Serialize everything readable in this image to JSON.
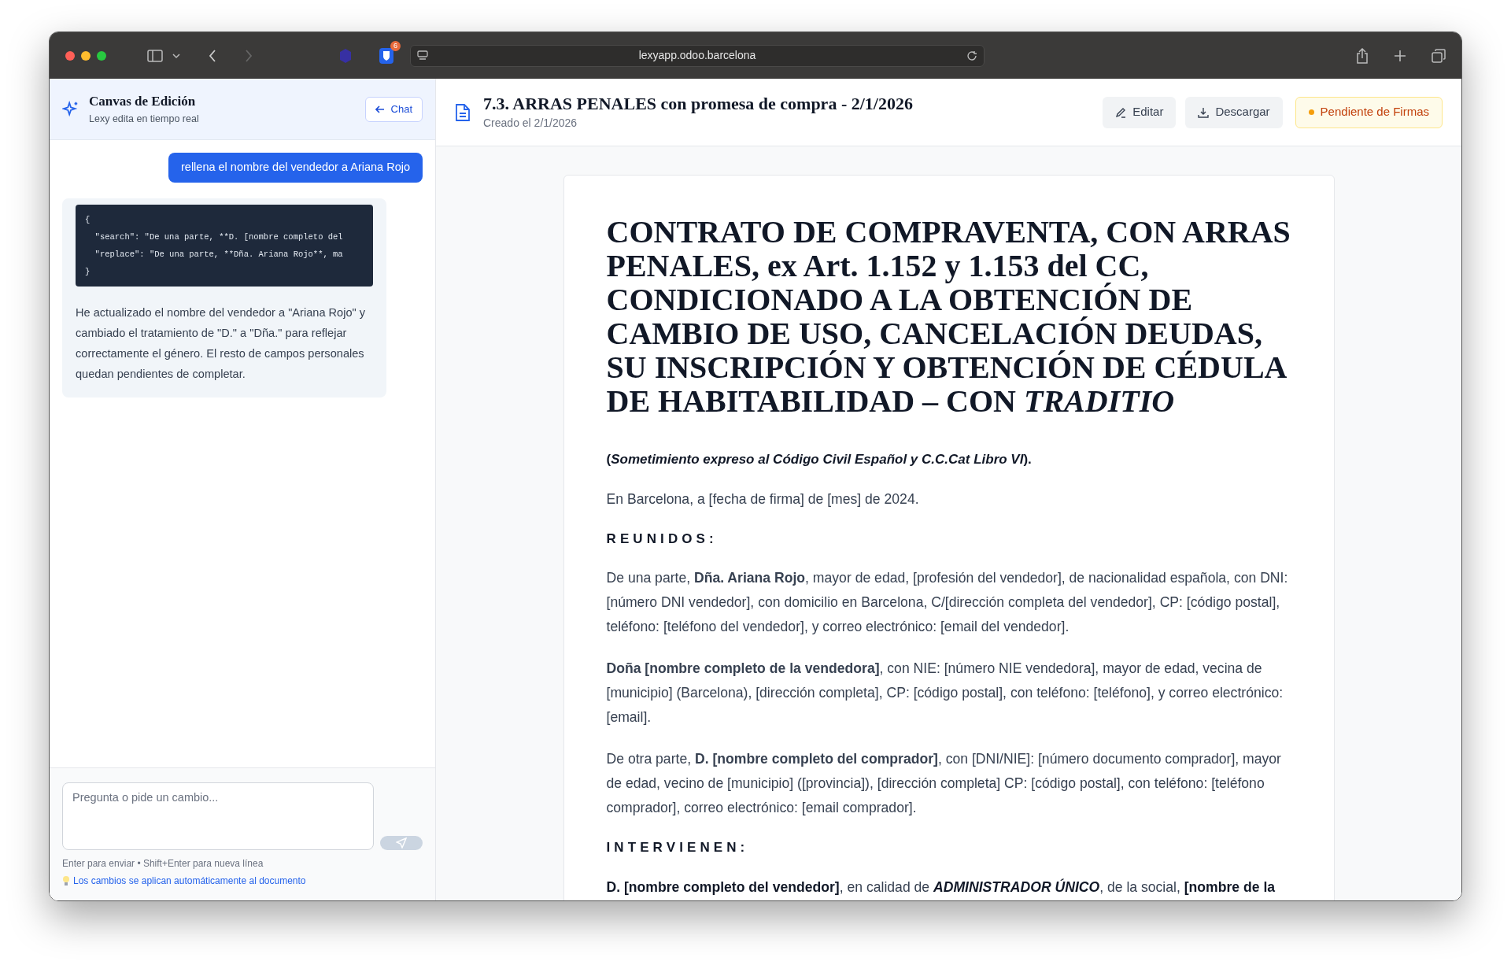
{
  "browser": {
    "url": "lexyapp.odoo.barcelona",
    "extension_badge": "6",
    "back_disabled": false,
    "forward_disabled": true
  },
  "chat_panel": {
    "title": "Canvas de Edición",
    "subtitle": "Lexy edita en tiempo real",
    "chat_button": "Chat",
    "messages": [
      {
        "kind": "user",
        "text": "rellena el nombre del vendedor a Ariana Rojo"
      },
      {
        "kind": "assistant",
        "code": [
          "{",
          "  \"search\": \"De una parte, **D. [nombre completo del",
          "  \"replace\": \"De una parte, **Dña. Ariana Rojo**, ma",
          "}"
        ],
        "text": "He actualizado el nombre del vendedor a \"Ariana Rojo\" y cambiado el tratamiento de \"D.\" a \"Dña.\" para reflejar correctamente el género. El resto de campos personales quedan pendientes de completar."
      }
    ],
    "input": {
      "placeholder": "Pregunta o pide un cambio..."
    },
    "send_disabled": true,
    "hint": "Enter para enviar • Shift+Enter para nueva línea",
    "tip": "Los cambios se aplican automáticamente al documento"
  },
  "document_header": {
    "title": "7.3. ARRAS PENALES con promesa de compra - 2/1/2026",
    "created": "Creado el 2/1/2026",
    "buttons": [
      {
        "kind": "edit",
        "label": "Editar"
      },
      {
        "kind": "download",
        "label": "Descargar"
      }
    ],
    "status": {
      "label": "Pendiente de Firmas",
      "color": "#f59e0b"
    }
  },
  "document": {
    "title": "CONTRATO DE COMPRAVENTA, CON ARRAS PENALES, ex Art. 1.152 y 1.153 del CC, CONDICIONADO A LA OBTENCIÓN DE CAMBIO DE USO, CANCELACIÓN DEUDAS, SU INSCRIPCIÓN Y OBTENCIÓN DE CÉDULA DE HABITABILIDAD – CON *TRADITIO*",
    "blocks": [
      {
        "kind": "bold",
        "text": "(*Sometimiento expreso al Código Civil Español y C.C.Cat Libro VI*)."
      },
      {
        "kind": "paragraph",
        "text": "En Barcelona, a [fecha de firma] de [mes] de 2024."
      },
      {
        "kind": "heading",
        "text": "REUNIDOS:"
      },
      {
        "kind": "paragraph",
        "text": "De una parte, **Dña. Ariana Rojo**, mayor de edad, [profesión del vendedor], de nacionalidad española, con DNI: [número DNI vendedor], con domicilio en Barcelona, C/[dirección completa del vendedor], CP: [código postal], teléfono: [teléfono del vendedor], y correo electrónico: [email del vendedor]."
      },
      {
        "kind": "paragraph",
        "text": "**Doña [nombre completo de la vendedora]**, con NIE: [número NIE vendedora], mayor de edad, vecina de [municipio] (Barcelona), [dirección completa], CP: [código postal], con teléfono: [teléfono], y correo electrónico: [email]."
      },
      {
        "kind": "paragraph",
        "text": "De otra parte, **D. [nombre completo del comprador]**, con [DNI/NIE]: [número documento comprador], mayor de edad, vecino de [municipio] ([provincia]), [dirección completa] CP: [código postal], con teléfono: [teléfono comprador], correo electrónico: [email comprador]."
      },
      {
        "kind": "heading",
        "text": "INTERVIENEN:"
      },
      {
        "kind": "segments",
        "segments": [
          {
            "text": "D. [nombre completo del vendedor]",
            "bold": true,
            "italic": false
          },
          {
            "text": ", en calidad de ",
            "bold": false,
            "italic": false
          },
          {
            "text": "ADMINISTRADOR ÚNICO",
            "bold": true,
            "italic": true
          },
          {
            "text": ", de la social, ",
            "bold": false,
            "italic": false
          },
          {
            "text": "[nombre de la",
            "bold": true,
            "italic": false
          }
        ]
      }
    ]
  }
}
